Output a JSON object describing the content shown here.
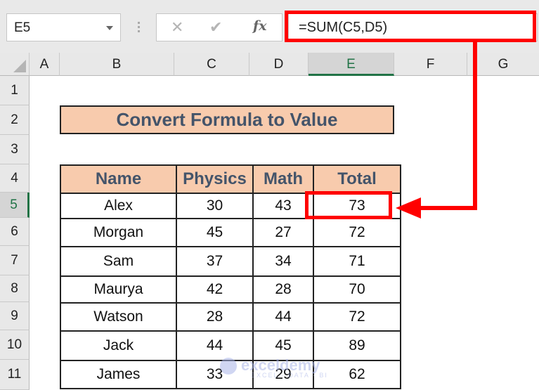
{
  "namebox": {
    "value": "E5"
  },
  "formula_bar": {
    "cancel_icon": "✕",
    "enter_icon": "✔",
    "fx_label": "fx",
    "formula": "=SUM(C5,D5)"
  },
  "columns": [
    "A",
    "B",
    "C",
    "D",
    "E",
    "F",
    "G"
  ],
  "selected_column": "E",
  "rows": [
    "1",
    "2",
    "3",
    "4",
    "5",
    "6",
    "7",
    "8",
    "9",
    "10",
    "11"
  ],
  "selected_row": "5",
  "sheet": {
    "title": "Convert Formula to Value",
    "headers": [
      "Name",
      "Physics",
      "Math",
      "Total"
    ],
    "records": [
      {
        "name": "Alex",
        "physics": "30",
        "math": "43",
        "total": "73"
      },
      {
        "name": "Morgan",
        "physics": "45",
        "math": "27",
        "total": "72"
      },
      {
        "name": "Sam",
        "physics": "37",
        "math": "34",
        "total": "71"
      },
      {
        "name": "Maurya",
        "physics": "42",
        "math": "28",
        "total": "70"
      },
      {
        "name": "Watson",
        "physics": "28",
        "math": "44",
        "total": "72"
      },
      {
        "name": "Jack",
        "physics": "44",
        "math": "45",
        "total": "89"
      },
      {
        "name": "James",
        "physics": "33",
        "math": "29",
        "total": "62"
      }
    ]
  },
  "annotation": {
    "highlight_color": "#ff0000"
  },
  "watermark": {
    "brand": "exceldemy",
    "tagline": "EXCEL · DATA · BI"
  }
}
